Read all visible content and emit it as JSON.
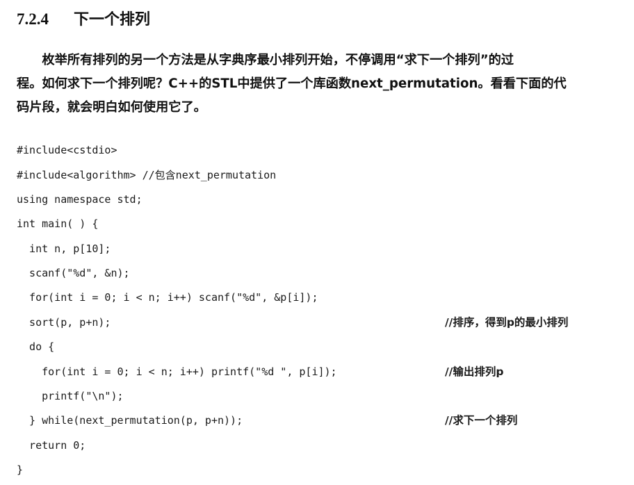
{
  "section": {
    "number": "7.2.4",
    "title": "下一个排列"
  },
  "paragraph": {
    "line1": "　　枚举所有排列的另一个方法是从字典序最小排列开始，不停调用“求下一个排列”的过",
    "line2": "程。如何求下一个排列呢？C++的STL中提供了一个库函数next_permutation。看看下面的代",
    "line3": "码片段，就会明白如何使用它了。"
  },
  "code": {
    "lines": [
      "#include<cstdio>",
      "#include<algorithm> //包含next_permutation",
      "using namespace std;",
      "int main( ) {",
      "  int n, p[10];",
      "  scanf(\"%d\", &n);",
      "  for(int i = 0; i < n; i++) scanf(\"%d\", &p[i]);",
      "  sort(p, p+n);",
      "  do {",
      "    for(int i = 0; i < n; i++) printf(\"%d \", p[i]);",
      "    printf(\"\\n\");",
      "  } while(next_permutation(p, p+n));",
      "  return 0;",
      "}"
    ],
    "comments": {
      "sort": "//排序，得到p的最小排列",
      "print": "//输出排列p",
      "next": "//求下一个排列"
    }
  }
}
